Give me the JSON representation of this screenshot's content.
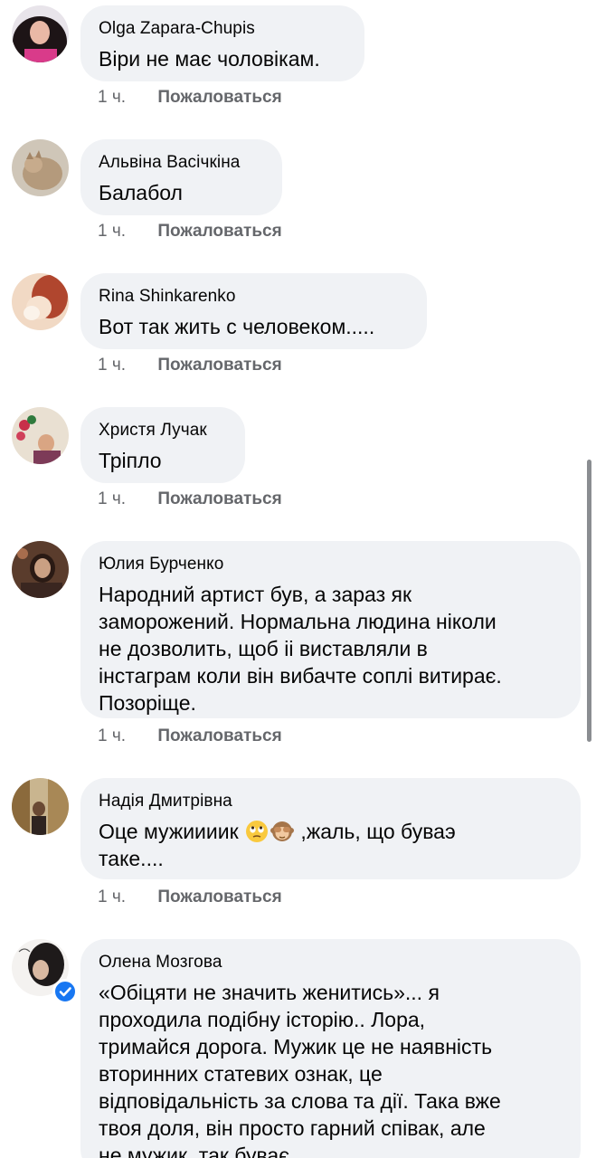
{
  "comments": [
    {
      "author": "Olga Zapara-Chupis",
      "text": "Віри не має чоловікам.",
      "time": "1 ч.",
      "report": "Пожаловаться"
    },
    {
      "author": "Альвіна Васічкіна",
      "text": "Балабол",
      "time": "1 ч.",
      "report": "Пожаловаться"
    },
    {
      "author": "Rina Shinkarenko",
      "text": "Вот так жить с человеком.....",
      "time": "1 ч.",
      "report": "Пожаловаться"
    },
    {
      "author": "Христя Лучак",
      "text": "Тріпло",
      "time": "1 ч.",
      "report": "Пожаловаться"
    },
    {
      "author": "Юлия Бурченко",
      "text": "Народний артист був, а зараз як\nзаморожений. Нормальна людина ніколи\nне дозволить, щоб іі виставляли в\nінстаграм коли він вибачте соплі витирає.\nПозоріще.",
      "time": "1 ч.",
      "report": "Пожаловаться"
    },
    {
      "author": "Надія Дмитрівна",
      "text_before_emoji": "Оце мужиииик ",
      "emoji": [
        "face-with-rolling-eyes-emoji",
        "see-no-evil-monkey-emoji"
      ],
      "text_after_emoji": " ,жаль, що буваэ\nтаке....",
      "time": "1 ч.",
      "report": "Пожаловаться"
    },
    {
      "author": "Олена Мозгова",
      "text": "«Обіцяти не значить женитись»... я\nпроходила подібну історію.. Лора,\nтримайся дорога. Мужик це не наявність\nвторинних статевих ознак, це\nвідповідальність за слова та дії. Така вже\nтвоя доля, він просто гарний співак, але\nне мужик, так буває.",
      "verified": true
    }
  ],
  "colors": {
    "bubble": "#f0f2f5",
    "meta": "#65676b",
    "verified_badge": "#1877f2",
    "scrollbar": "#8a8d91"
  }
}
